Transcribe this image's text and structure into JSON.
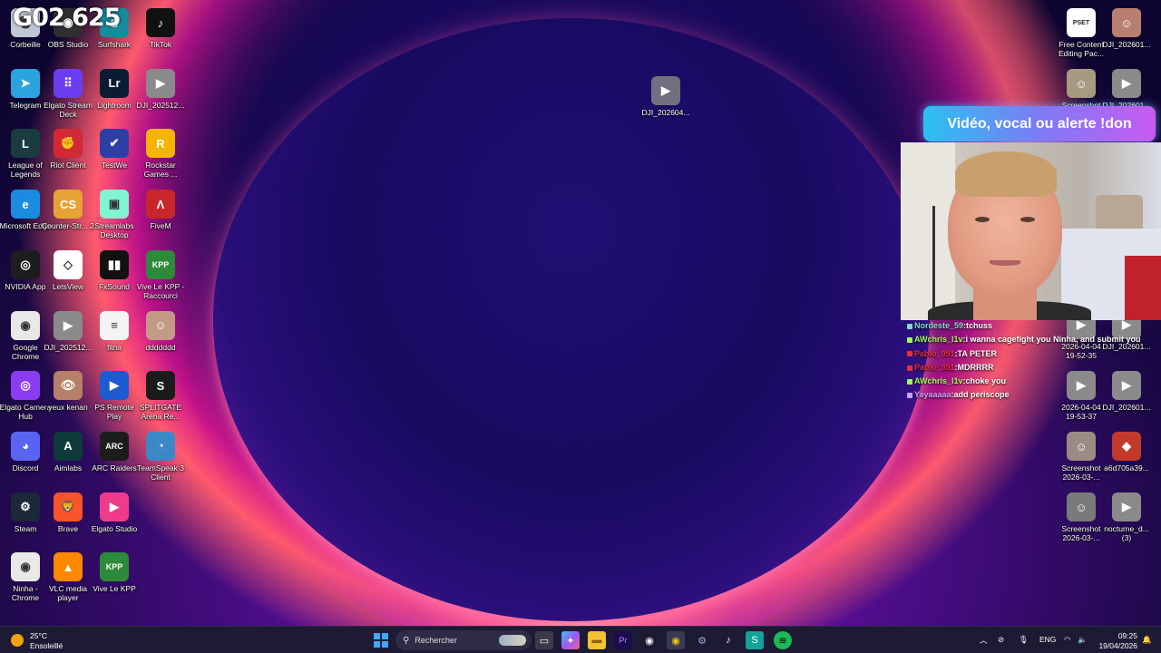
{
  "desktop": {
    "overlay_text": "G02 625",
    "icons": [
      {
        "label": "Corbeille",
        "icon": "recycle-bin-icon",
        "color": "#bfc7d6",
        "glyph": "🗑"
      },
      {
        "label": "OBS Studio",
        "icon": "obs-icon",
        "color": "#302e31",
        "glyph": "◉"
      },
      {
        "label": "Surfshark",
        "icon": "surfshark-icon",
        "color": "#178a9e",
        "glyph": "S"
      },
      {
        "label": "TikTok",
        "icon": "tiktok-icon",
        "color": "#111111",
        "glyph": "♪"
      },
      {
        "label": "Telegram",
        "icon": "telegram-icon",
        "color": "#2aa3df",
        "glyph": "➤"
      },
      {
        "label": "Elgato Stream Deck",
        "icon": "stream-deck-icon",
        "color": "#6b3cf0",
        "glyph": "⠿"
      },
      {
        "label": "Lightroom",
        "icon": "lightroom-icon",
        "color": "#0a1c33",
        "glyph": "Lr"
      },
      {
        "label": "DJI_202512...",
        "icon": "video-file-icon",
        "color": "#8a8a8a",
        "glyph": "▶"
      },
      {
        "label": "League of Legends",
        "icon": "league-icon",
        "color": "#1a3b3f",
        "glyph": "L"
      },
      {
        "label": "Riot Client",
        "icon": "riot-icon",
        "color": "#d32936",
        "glyph": "✊"
      },
      {
        "label": "TestWe",
        "icon": "testwe-icon",
        "color": "#2c3fa5",
        "glyph": "✔"
      },
      {
        "label": "Rockstar Games ...",
        "icon": "rockstar-icon",
        "color": "#f3b500",
        "glyph": "R"
      },
      {
        "label": "Microsoft Edge",
        "icon": "edge-icon",
        "color": "#1b8be0",
        "glyph": "e"
      },
      {
        "label": "Counter-Str... 2",
        "icon": "counter-strike-icon",
        "color": "#e7a235",
        "glyph": "CS"
      },
      {
        "label": "Streamlabs Desktop",
        "icon": "streamlabs-icon",
        "color": "#80f5d2",
        "glyph": "▣"
      },
      {
        "label": "FiveM",
        "icon": "fivem-icon",
        "color": "#c9262c",
        "glyph": "Λ"
      },
      {
        "label": "NVIDIA App",
        "icon": "nvidia-icon",
        "color": "#1d1d1d",
        "glyph": "◎"
      },
      {
        "label": "LetsView",
        "icon": "letsview-icon",
        "color": "#ffffff",
        "glyph": "◇"
      },
      {
        "label": "FxSound",
        "icon": "fxsound-icon",
        "color": "#111111",
        "glyph": "▮▮"
      },
      {
        "label": "Vive Le KPP - Raccourci",
        "icon": "kpp-icon",
        "color": "#2c8a3a",
        "glyph": "KPP"
      },
      {
        "label": "Google Chrome",
        "icon": "chrome-icon",
        "color": "#e8e8e8",
        "glyph": "◉"
      },
      {
        "label": "DJI_202512...",
        "icon": "video-file-icon",
        "color": "#8a8a8a",
        "glyph": "▶"
      },
      {
        "label": "fitna",
        "icon": "text-file-icon",
        "color": "#f4f4f4",
        "glyph": "≡"
      },
      {
        "label": "ddddddd",
        "icon": "image-file-icon",
        "color": "#c29a86",
        "glyph": "☺"
      },
      {
        "label": "Elgato Camera Hub",
        "icon": "camera-hub-icon",
        "color": "#8b3cf0",
        "glyph": "◎"
      },
      {
        "label": "yeux kenan",
        "icon": "image-file-icon",
        "color": "#b58067",
        "glyph": "👁"
      },
      {
        "label": "PS Remote Play",
        "icon": "ps-remote-icon",
        "color": "#1e5bd1",
        "glyph": "▶"
      },
      {
        "label": "SPLITGATE Arena Re...",
        "icon": "splitgate-icon",
        "color": "#1b1b1b",
        "glyph": "S"
      },
      {
        "label": "Discord",
        "icon": "discord-icon",
        "color": "#5865f2",
        "glyph": "◕"
      },
      {
        "label": "Aimlabs",
        "icon": "aimlabs-icon",
        "color": "#0f3a3a",
        "glyph": "A"
      },
      {
        "label": "ARC Raiders",
        "icon": "arc-raiders-icon",
        "color": "#1c1c1c",
        "glyph": "ARC"
      },
      {
        "label": "TeamSpeak 3 Client",
        "icon": "teamspeak-icon",
        "color": "#3b87c8",
        "glyph": "◔"
      },
      {
        "label": "Steam",
        "icon": "steam-icon",
        "color": "#1b2838",
        "glyph": "⚙"
      },
      {
        "label": "Brave",
        "icon": "brave-icon",
        "color": "#fb542b",
        "glyph": "🦁"
      },
      {
        "label": "Elgato Studio",
        "icon": "elgato-studio-icon",
        "color": "#f03b8d",
        "glyph": "▶"
      },
      {
        "label": "",
        "icon": "",
        "color": "",
        "glyph": ""
      },
      {
        "label": "Ninha - Chrome",
        "icon": "chrome-icon",
        "color": "#e8e8e8",
        "glyph": "◉"
      },
      {
        "label": "VLC media player",
        "icon": "vlc-icon",
        "color": "#ff8800",
        "glyph": "▲"
      },
      {
        "label": "Vive Le KPP",
        "icon": "kpp-icon",
        "color": "#2c8a3a",
        "glyph": "KPP"
      }
    ],
    "center_icon": {
      "label": "DJI_202604...",
      "icon": "video-file-icon"
    },
    "right_icons": [
      {
        "label": "Free Content Editing Pac...",
        "icon": "pset-icon",
        "glyph": "PSET",
        "color": "#ffffff"
      },
      {
        "label": "DJI_202601...",
        "icon": "image-file-icon",
        "glyph": "☺",
        "color": "#b87f70"
      },
      {
        "label": "Screenshot",
        "icon": "image-file-icon",
        "glyph": "☺",
        "color": "#a69a80"
      },
      {
        "label": "DJI_202601...",
        "icon": "video-file-icon",
        "glyph": "▶",
        "color": "#8a8a8a"
      },
      {
        "label": "2026-04-04 19-52-35",
        "icon": "video-file-icon",
        "glyph": "▶",
        "color": "#8a8a8a"
      },
      {
        "label": "DJI_202601...",
        "icon": "video-file-icon",
        "glyph": "▶",
        "color": "#8a8a8a"
      },
      {
        "label": "2026-04-04 19-53-37",
        "icon": "video-file-icon",
        "glyph": "▶",
        "color": "#8a8a8a"
      },
      {
        "label": "DJI_202601...",
        "icon": "video-file-icon",
        "glyph": "▶",
        "color": "#8a8a8a"
      },
      {
        "label": "Screenshot 2026-03-...",
        "icon": "image-file-icon",
        "glyph": "☺",
        "color": "#9a8c84"
      },
      {
        "label": "a6d705a39...",
        "icon": "image-file-icon",
        "glyph": "◆",
        "color": "#c0392b"
      },
      {
        "label": "Screenshot 2026-03-...",
        "icon": "image-file-icon",
        "glyph": "☺",
        "color": "#7a7a7a"
      },
      {
        "label": "nocturne_d... (3)",
        "icon": "video-file-icon",
        "glyph": "▶",
        "color": "#8a8a8a"
      }
    ]
  },
  "stream_overlay": {
    "banner": "Vidéo, vocal ou alerte !don",
    "chat": [
      {
        "user": "Nordeste_59",
        "user_color": "#7ee0c5",
        "message": "tchuss"
      },
      {
        "user": "AWchris_l1v",
        "user_color": "#9cff57",
        "message": "i wanna cagefight you Ninha, and submit you"
      },
      {
        "user": "Pablo_951",
        "user_color": "#e0303a",
        "message": "TA PETER"
      },
      {
        "user": "Pablo_951",
        "user_color": "#e0303a",
        "message": "MDRRRR"
      },
      {
        "user": "AWchris_l1v",
        "user_color": "#9cff57",
        "message": "choke you"
      },
      {
        "user": "Yayaaaaa",
        "user_color": "#c9a0ff",
        "message": "add periscope"
      }
    ]
  },
  "taskbar": {
    "weather_temp": "25°C",
    "weather_desc": "Ensoleillé",
    "search_placeholder": "Rechercher",
    "language": "ENG",
    "time": "09:25",
    "date": "19/04/2026"
  }
}
